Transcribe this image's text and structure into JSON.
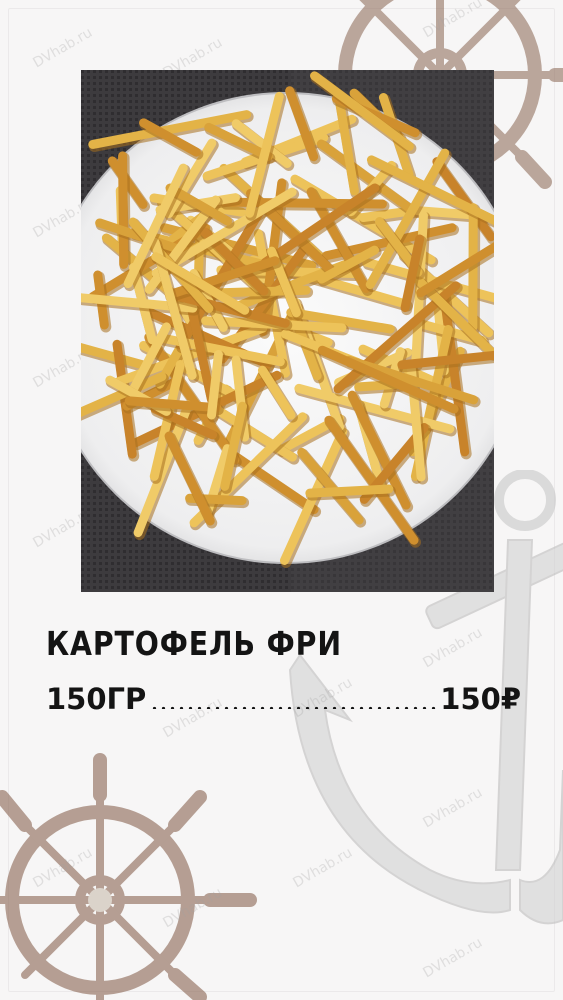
{
  "dish": {
    "title": "КАРТОФЕЛЬ ФРИ",
    "weight": "150ГР",
    "price": "150₽"
  },
  "watermark": {
    "text": "DVhab.ru"
  },
  "decorations": {
    "wheel_color": "#8a6552",
    "anchor_color": "#c9c9c9",
    "icons": [
      "ship-wheel-icon",
      "anchor-icon"
    ]
  }
}
